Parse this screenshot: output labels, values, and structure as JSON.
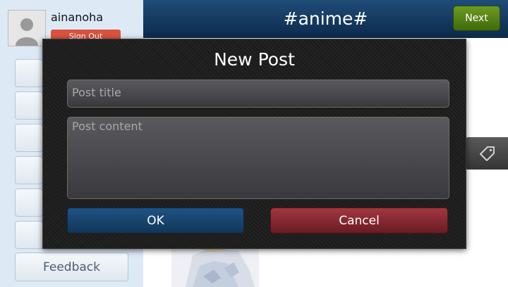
{
  "sidebar": {
    "username": "ainanoha",
    "signout_label": "Sign Out",
    "feedback_label": "Feedback"
  },
  "topbar": {
    "title": "#anime#",
    "next_label": "Next"
  },
  "dialog": {
    "title": "New Post",
    "post_title_placeholder": "Post title",
    "post_content_placeholder": "Post content",
    "ok_label": "OK",
    "cancel_label": "Cancel"
  },
  "icons": {
    "tag": "tag-icon",
    "avatar": "user-silhouette-icon"
  },
  "colors": {
    "topbar": "#163c64",
    "next_button": "#557f14",
    "signout_button": "#d9533e",
    "ok_button": "#1a4570",
    "cancel_button": "#8a2830",
    "sidebar_bg": "#dde9f5"
  }
}
